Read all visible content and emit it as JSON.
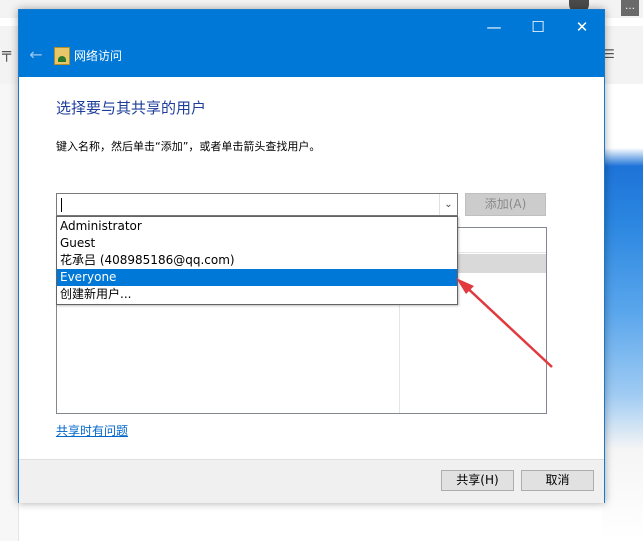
{
  "window": {
    "title": "网络访问",
    "controls": {
      "minimize": "—",
      "maximize": "☐",
      "close": "✕"
    },
    "back_icon": "back-arrow-icon"
  },
  "content": {
    "heading": "选择要与其共享的用户",
    "instruction": "键入名称，然后单击“添加”，或者单击箭头查找用户。",
    "combo_value": "",
    "add_button": "添加(A)",
    "dropdown_items": [
      "Administrator",
      "Guest",
      "花承吕 (408985186@qq.com)",
      "Everyone",
      "创建新用户..."
    ],
    "selected_item": "Everyone",
    "help_link": "共享时有问题"
  },
  "footer": {
    "share_button": "共享(H)",
    "cancel_button": "取消"
  },
  "colors": {
    "titlebar": "#0078d7",
    "heading": "#1e3e9a",
    "selection": "#0078d7",
    "annotation_arrow": "#e0393e"
  }
}
